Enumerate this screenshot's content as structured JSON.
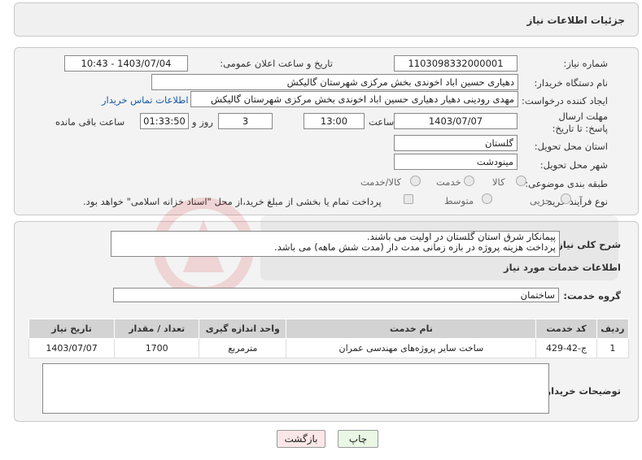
{
  "header": {
    "title": "جزئیات اطلاعات نیاز"
  },
  "info": {
    "need_number_label": "شماره نیاز:",
    "need_number": "1103098332000001",
    "announce_label": "تاریخ و ساعت اعلان عمومی:",
    "announce_value": "1403/07/04 - 10:43",
    "buyer_org_label": "نام دستگاه خریدار:",
    "buyer_org": "دهیاری حسین اباد اخوندی بخش مرکزی شهرستان گالیکش",
    "creator_label": "ایجاد کننده درخواست:",
    "creator": "مهدی رودینی دهیار دهیاری حسین اباد اخوندی بخش مرکزی شهرستان گالیکش",
    "contact_link": "اطلاعات تماس خریدار",
    "deadline_label": "مهلت ارسال پاسخ: تا تاریخ:",
    "deadline_date": "1403/07/07",
    "time_label": "ساعت",
    "deadline_time": "13:00",
    "days_value": "3",
    "days_label": "روز و",
    "remaining_time": "01:33:50",
    "remaining_label": "ساعت باقی مانده",
    "province_label": "استان محل تحویل:",
    "province": "گلستان",
    "city_label": "شهر محل تحویل:",
    "city": "مینودشت",
    "category_label": "طبقه بندی موضوعی:",
    "category_options": [
      "کالا",
      "خدمت",
      "کالا/خدمت"
    ],
    "process_label": "نوع فرآیند خرید :",
    "process_options": [
      "جزیی",
      "متوسط"
    ],
    "payment_note": "پرداخت تمام یا بخشی از مبلغ خرید،از محل \"اسناد خزانه اسلامی\" خواهد بود."
  },
  "detail": {
    "summary_label": "شرح کلی نیاز:",
    "summary_line1": "پیمانکار شرق استان گلستان در اولیت می باشند.",
    "summary_line2": "پرداخت هزینه پروژه در بازه زمانی مدت دار (مدت شش ماهه) می باشد.",
    "services_heading": "اطلاعات خدمات مورد نیاز",
    "service_group_label": "گروه خدمت:",
    "service_group": "ساختمان",
    "table_headers": [
      "ردیف",
      "کد خدمت",
      "نام خدمت",
      "واحد اندازه گیری",
      "تعداد / مقدار",
      "تاریخ نیاز"
    ],
    "rows": [
      [
        "1",
        "ج-42-429",
        "ساخت سایر پروژه‌های مهندسی عمران",
        "مترمربع",
        "1700",
        "1403/07/07"
      ]
    ],
    "buyer_notes_label": "توضیحات خریدار:",
    "buyer_notes": ""
  },
  "buttons": {
    "print": "چاپ",
    "back": "بازگشت"
  },
  "colors": {
    "link": "#1a5aa8",
    "print_bg": "#e9f7e4",
    "back_bg": "#fbe7e7",
    "header_bg": "#d3d3d3"
  }
}
